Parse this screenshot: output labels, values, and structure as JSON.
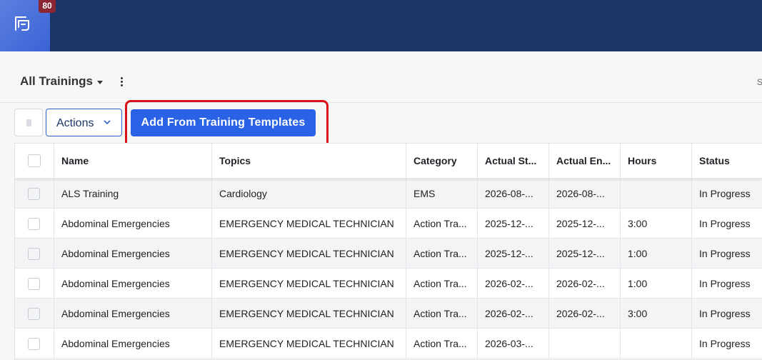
{
  "app": {
    "notification_count": "80",
    "logo_icon": "app-logo-icon"
  },
  "view": {
    "title": "All Trainings",
    "right_label": "S"
  },
  "toolbar": {
    "actions_label": "Actions",
    "add_template_label": "Add From Training Templates"
  },
  "table": {
    "columns": [
      "Name",
      "Topics",
      "Category",
      "Actual St...",
      "Actual En...",
      "Hours",
      "Status"
    ],
    "rows": [
      {
        "name": "ALS Training",
        "topics": "Cardiology",
        "category": "EMS",
        "actual_start": "2026-08-...",
        "actual_end": "2026-08-...",
        "hours": "",
        "status": "In Progress"
      },
      {
        "name": "Abdominal Emergencies",
        "topics": "EMERGENCY MEDICAL TECHNICIAN",
        "category": "Action Tra...",
        "actual_start": "2025-12-...",
        "actual_end": "2025-12-...",
        "hours": "3:00",
        "status": "In Progress"
      },
      {
        "name": "Abdominal Emergencies",
        "topics": "EMERGENCY MEDICAL TECHNICIAN",
        "category": "Action Tra...",
        "actual_start": "2025-12-...",
        "actual_end": "2025-12-...",
        "hours": "1:00",
        "status": "In Progress"
      },
      {
        "name": "Abdominal Emergencies",
        "topics": "EMERGENCY MEDICAL TECHNICIAN",
        "category": "Action Tra...",
        "actual_start": "2026-02-...",
        "actual_end": "2026-02-...",
        "hours": "1:00",
        "status": "In Progress"
      },
      {
        "name": "Abdominal Emergencies",
        "topics": "EMERGENCY MEDICAL TECHNICIAN",
        "category": "Action Tra...",
        "actual_start": "2026-02-...",
        "actual_end": "2026-02-...",
        "hours": "3:00",
        "status": "In Progress"
      },
      {
        "name": "Abdominal Emergencies",
        "topics": "EMERGENCY MEDICAL TECHNICIAN",
        "category": "Action Tra...",
        "actual_start": "2026-03-...",
        "actual_end": "",
        "hours": "",
        "status": "In Progress"
      }
    ]
  },
  "colors": {
    "topbar": "#1b3566",
    "primary": "#2a62e6",
    "highlight": "#d8121b",
    "badge": "#8a2533"
  }
}
